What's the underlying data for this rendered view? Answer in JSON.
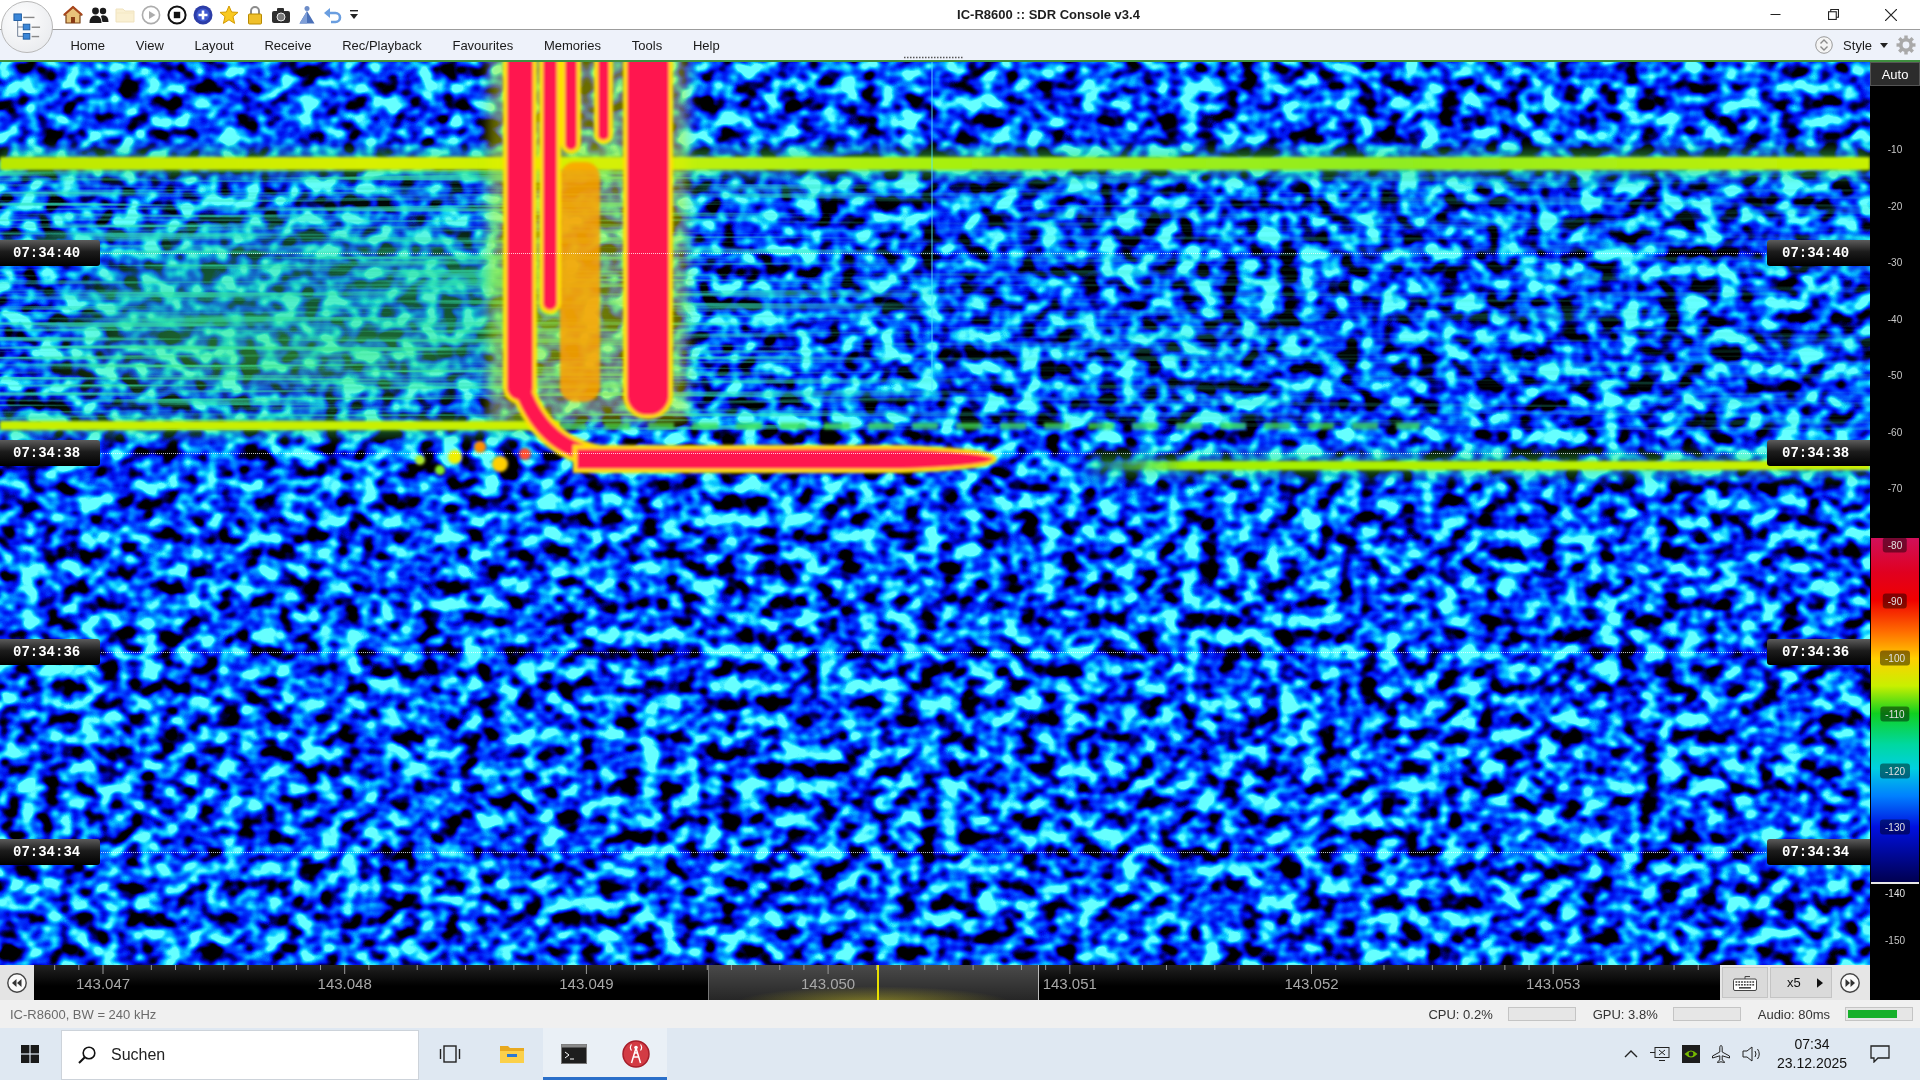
{
  "window": {
    "title": "IC-R8600 :: SDR Console v3.4"
  },
  "quick_access": [
    {
      "kind": "home",
      "disabled": false
    },
    {
      "kind": "people",
      "disabled": false
    },
    {
      "kind": "folder",
      "disabled": true
    },
    {
      "kind": "play",
      "disabled": true
    },
    {
      "kind": "stop",
      "disabled": false
    },
    {
      "kind": "add",
      "disabled": false
    },
    {
      "kind": "star",
      "disabled": false
    },
    {
      "kind": "lock",
      "disabled": false
    },
    {
      "kind": "camera",
      "disabled": false
    },
    {
      "kind": "cone",
      "disabled": false
    },
    {
      "kind": "undo",
      "disabled": false
    },
    {
      "kind": "more",
      "disabled": false
    }
  ],
  "menu": {
    "items": [
      "Home",
      "View",
      "Layout",
      "Receive",
      "Rec/Playback",
      "Favourites",
      "Memories",
      "Tools",
      "Help"
    ],
    "style_label": "Style"
  },
  "waterfall": {
    "time_marks": [
      {
        "left": "07:34:40",
        "right": "07:34:40"
      },
      {
        "left": "07:34:38",
        "right": "07:34:38"
      },
      {
        "left": "07:34:36",
        "right": "07:34:36"
      },
      {
        "left": "07:34:34",
        "right": "07:34:34"
      }
    ]
  },
  "level_scale": {
    "mode": "Auto",
    "ticks": [
      {
        "label": "-10",
        "kind": "plain"
      },
      {
        "label": "-20",
        "kind": "plain"
      },
      {
        "label": "-30",
        "kind": "plain"
      },
      {
        "label": "-40",
        "kind": "plain"
      },
      {
        "label": "-50",
        "kind": "plain"
      },
      {
        "label": "-60",
        "kind": "plain"
      },
      {
        "label": "-70",
        "kind": "plain"
      },
      {
        "label": "-80",
        "kind": "band"
      },
      {
        "label": "-90",
        "kind": "band"
      },
      {
        "label": "-100",
        "kind": "band"
      },
      {
        "label": "-110",
        "kind": "band"
      },
      {
        "label": "-120",
        "kind": "band"
      },
      {
        "label": "-130",
        "kind": "band"
      },
      {
        "label": "-140",
        "kind": "marker"
      },
      {
        "label": "-150",
        "kind": "plain"
      }
    ]
  },
  "frequency_axis": {
    "labels": [
      "143.047",
      "143.048",
      "143.049",
      "143.050",
      "143.051",
      "143.052",
      "143.053"
    ],
    "zoom": "x5"
  },
  "status_bar": {
    "device": "IC-R8600, BW = 240 kHz",
    "meters": [
      {
        "label": "CPU: 0.2%"
      },
      {
        "label": "GPU: 3.8%"
      },
      {
        "label": "Audio: 80ms",
        "level": 0.8
      }
    ]
  },
  "taskbar": {
    "search": {
      "placeholder": "Suchen"
    },
    "apps": [
      {
        "kind": "explorer",
        "running": false
      },
      {
        "kind": "terminal",
        "running": true
      },
      {
        "kind": "radio",
        "running": true
      }
    ],
    "clock": {
      "time": "07:34",
      "date": "23.12.2025"
    }
  }
}
